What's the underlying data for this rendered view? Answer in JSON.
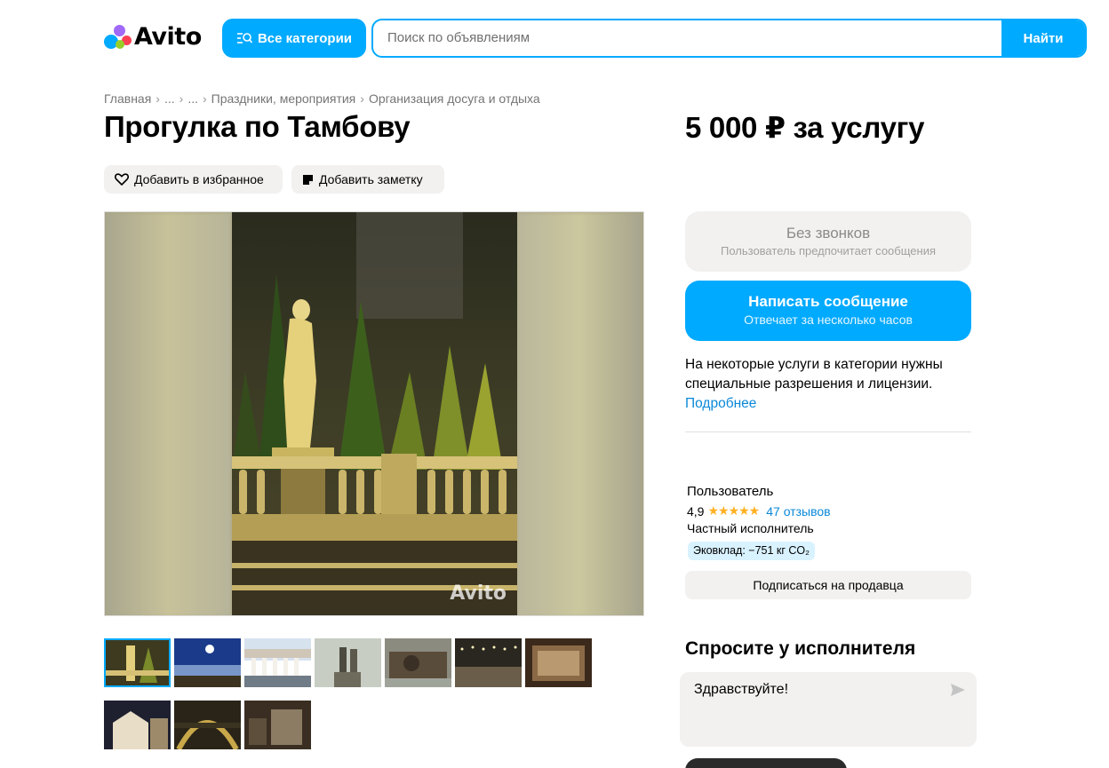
{
  "header": {
    "logo_text": "Avito",
    "categories_label": "Все категории",
    "search_placeholder": "Поиск по объявлениям",
    "search_button": "Найти"
  },
  "breadcrumb": [
    "Главная",
    "...",
    "...",
    "Праздники, мероприятия",
    "Организация досуга и отдыха"
  ],
  "listing": {
    "title": "Прогулка по Тамбову",
    "price": "5 000 ₽ за услугу",
    "favorite_label": "Добавить в избранное",
    "note_label": "Добавить заметку",
    "watermark": "Avito"
  },
  "contact": {
    "no_calls_title": "Без звонков",
    "no_calls_sub": "Пользователь предпочитает сообщения",
    "message_title": "Написать сообщение",
    "message_sub": "Отвечает за несколько часов",
    "notice_text": "На некоторые услуги в категории нужны специальные разрешения и лицензии.",
    "notice_link": "Подробнее"
  },
  "seller": {
    "name": "Пользователь",
    "rating": "4,9",
    "stars": 5,
    "reviews": "47 отзывов",
    "type": "Частный исполнитель",
    "eco": "Эковклад: −751 кг CO₂",
    "subscribe": "Подписаться на продавца"
  },
  "ask": {
    "title": "Спросите у исполнителя",
    "message": "Здравствуйте!"
  },
  "gallery": {
    "thumb_count": 10,
    "active_thumb": 1
  },
  "colors": {
    "accent": "#00aaff",
    "chip_bg": "#f2f1f0",
    "link": "#0a88d8",
    "star": "#ffb021"
  }
}
